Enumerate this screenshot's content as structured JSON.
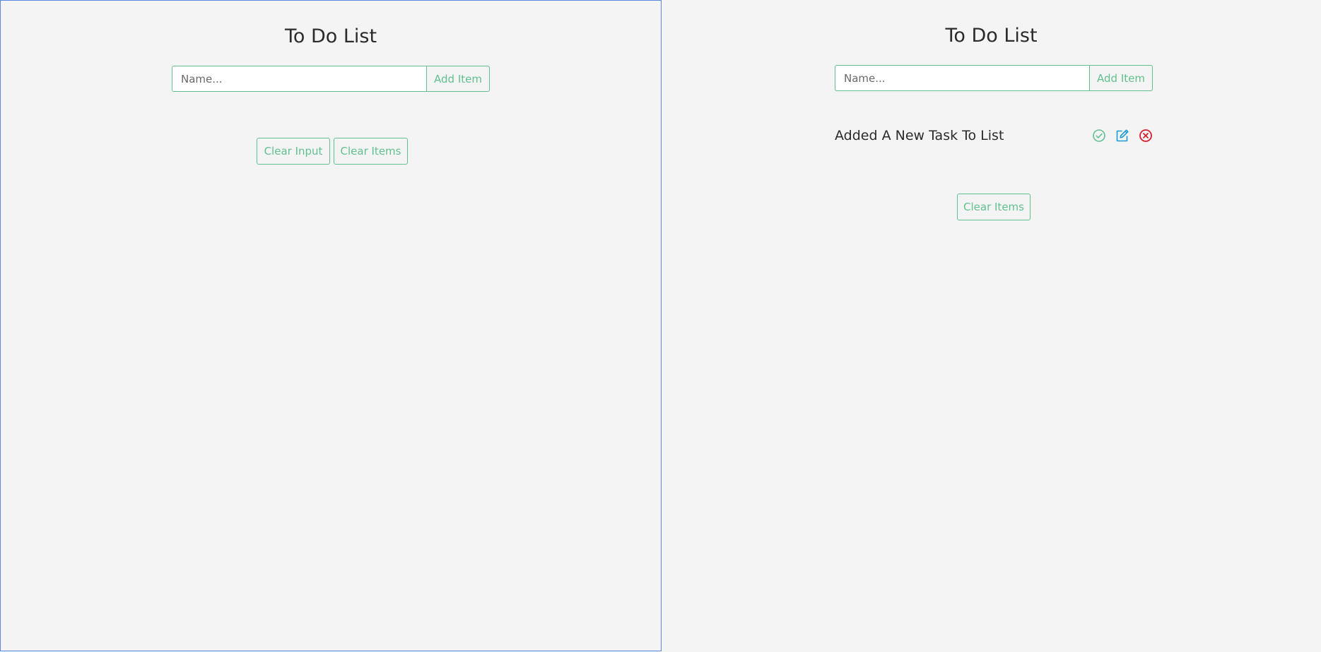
{
  "left_panel": {
    "title": "To Do List",
    "input_placeholder": "Name...",
    "add_label": "Add Item",
    "clear_input_label": "Clear Input",
    "clear_items_label": "Clear Items"
  },
  "right_panel": {
    "title": "To Do List",
    "input_placeholder": "Name...",
    "add_label": "Add Item",
    "tasks": [
      {
        "text": "Added A New Task To List",
        "icons": [
          "check-circle-icon",
          "edit-icon",
          "delete-circle-icon"
        ]
      }
    ],
    "clear_items_label": "Clear Items"
  },
  "colors": {
    "background": "#f4f4f4",
    "accent_green": "#62c08f",
    "edit_blue": "#1a9ad6",
    "delete_red": "#d61f2c",
    "focus_border": "#5b86e5"
  }
}
